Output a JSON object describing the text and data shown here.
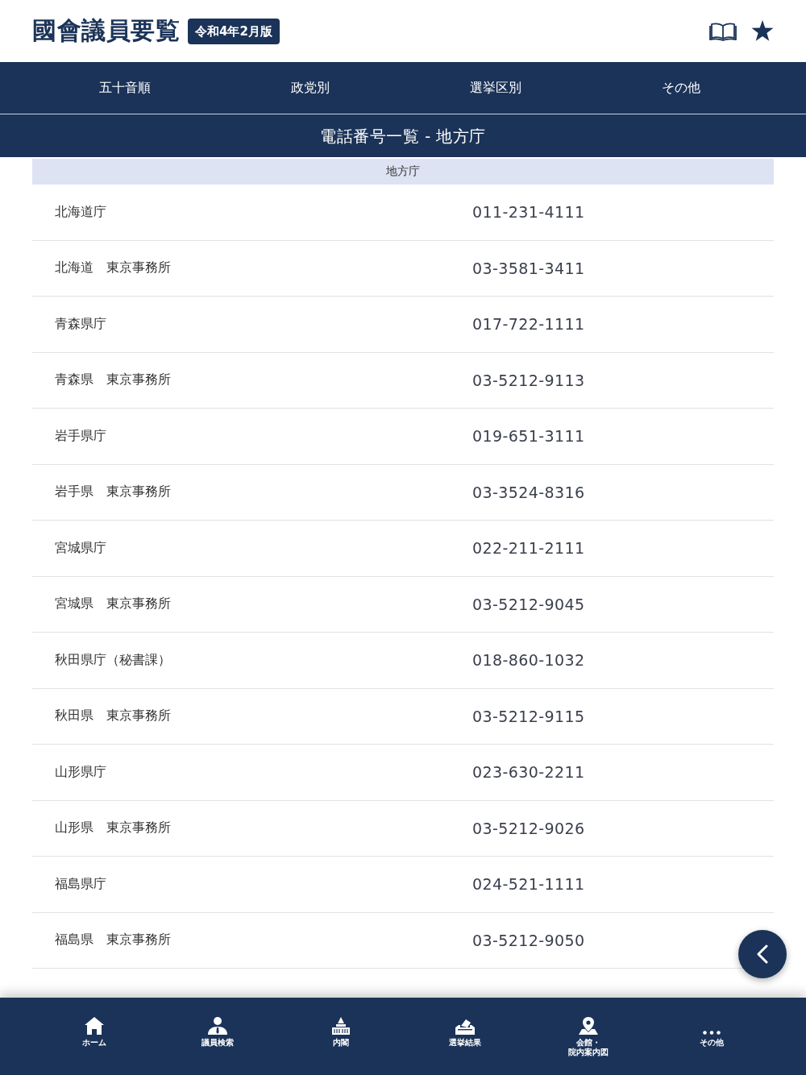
{
  "header": {
    "title": "國會議員要覧",
    "edition_badge": "令和4年2月版"
  },
  "tabs": [
    {
      "label": "五十音順"
    },
    {
      "label": "政党別"
    },
    {
      "label": "選挙区別"
    },
    {
      "label": "その他"
    }
  ],
  "page_title": "電話番号一覧 - 地方庁",
  "section_header": "地方庁",
  "rows": [
    {
      "name": "北海道庁",
      "phone": "011-231-4111"
    },
    {
      "name": "北海道　東京事務所",
      "phone": "03-3581-3411"
    },
    {
      "name": "青森県庁",
      "phone": "017-722-1111"
    },
    {
      "name": "青森県　東京事務所",
      "phone": "03-5212-9113"
    },
    {
      "name": "岩手県庁",
      "phone": "019-651-3111"
    },
    {
      "name": "岩手県　東京事務所",
      "phone": "03-3524-8316"
    },
    {
      "name": "宮城県庁",
      "phone": "022-211-2111"
    },
    {
      "name": "宮城県　東京事務所",
      "phone": "03-5212-9045"
    },
    {
      "name": "秋田県庁（秘書課）",
      "phone": "018-860-1032"
    },
    {
      "name": "秋田県　東京事務所",
      "phone": "03-5212-9115"
    },
    {
      "name": "山形県庁",
      "phone": "023-630-2211"
    },
    {
      "name": "山形県　東京事務所",
      "phone": "03-5212-9026"
    },
    {
      "name": "福島県庁",
      "phone": "024-521-1111"
    },
    {
      "name": "福島県　東京事務所",
      "phone": "03-5212-9050"
    }
  ],
  "bottom_nav": [
    {
      "label_lines": [
        "ホーム"
      ]
    },
    {
      "label_lines": [
        "議員検索"
      ]
    },
    {
      "label_lines": [
        "内閣"
      ]
    },
    {
      "label_lines": [
        "選挙結果"
      ]
    },
    {
      "label_lines": [
        "会館・",
        "院内案内図"
      ]
    },
    {
      "label_lines": [
        "その他"
      ]
    }
  ]
}
